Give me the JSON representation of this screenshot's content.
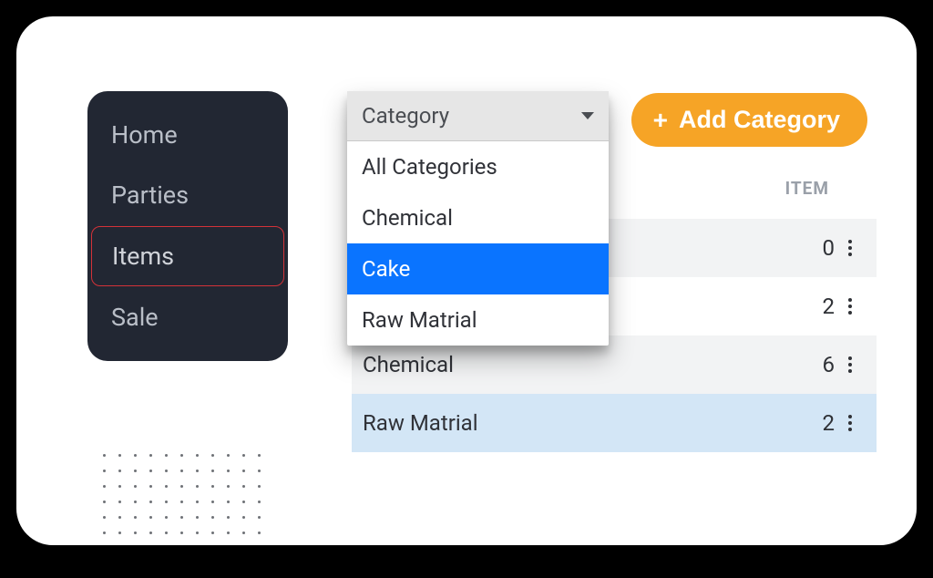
{
  "sidebar": {
    "items": [
      {
        "label": "Home",
        "active": false
      },
      {
        "label": "Parties",
        "active": false
      },
      {
        "label": "Items",
        "active": true
      },
      {
        "label": "Sale",
        "active": false
      }
    ]
  },
  "toolbar": {
    "add_category_label": "Add Category",
    "plus_glyph": "+"
  },
  "dropdown": {
    "header_label": "Category",
    "options": [
      {
        "label": "All Categories",
        "selected": false
      },
      {
        "label": "Chemical",
        "selected": false
      },
      {
        "label": "Cake",
        "selected": true
      },
      {
        "label": "Raw Matrial",
        "selected": false
      }
    ]
  },
  "table": {
    "header_item": "ITEM",
    "rows": [
      {
        "name": "",
        "count": 0,
        "variant": "alt"
      },
      {
        "name": "",
        "count": 2,
        "variant": ""
      },
      {
        "name": "Chemical",
        "count": 6,
        "variant": "alt"
      },
      {
        "name": "Raw Matrial",
        "count": 2,
        "variant": "sel"
      }
    ]
  },
  "colors": {
    "accent_orange": "#f6a426",
    "sidebar_bg": "#222733",
    "active_border": "#d33238",
    "dropdown_selected": "#0a74ff",
    "row_selected": "#d3e6f6"
  }
}
